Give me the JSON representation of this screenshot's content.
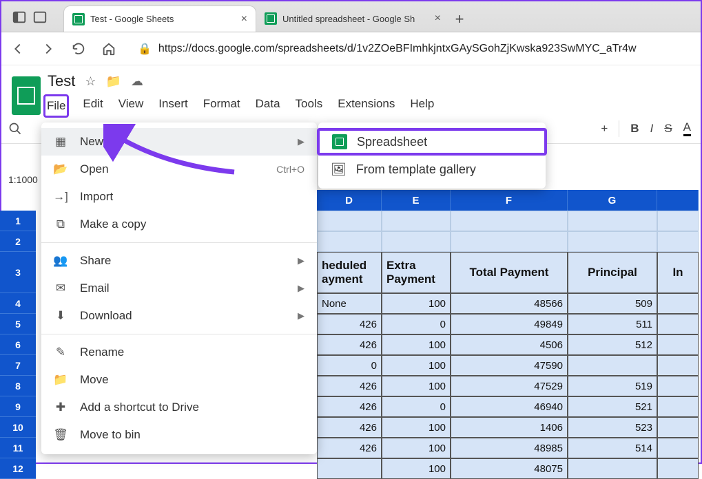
{
  "browser": {
    "tabs": [
      {
        "title": "Test - Google Sheets"
      },
      {
        "title": "Untitled spreadsheet - Google Sh"
      }
    ],
    "url": "https://docs.google.com/spreadsheets/d/1v2ZOeBFImhkjntxGAySGohZjKwska923SwMYC_aTr4w"
  },
  "doc": {
    "title": "Test",
    "menus": [
      "File",
      "Edit",
      "View",
      "Insert",
      "Format",
      "Data",
      "Tools",
      "Extensions",
      "Help"
    ]
  },
  "rangebox": "1:1000",
  "file_menu": {
    "new": "New",
    "open": "Open",
    "open_shortcut": "Ctrl+O",
    "import": "Import",
    "copy": "Make a copy",
    "share": "Share",
    "email": "Email",
    "download": "Download",
    "rename": "Rename",
    "move": "Move",
    "shortcut": "Add a shortcut to Drive",
    "bin": "Move to bin"
  },
  "submenu": {
    "spreadsheet": "Spreadsheet",
    "template": "From template gallery"
  },
  "toolbar": {
    "plus": "+",
    "bold": "B",
    "italic": "I",
    "strike": "S",
    "textcolor": "A"
  },
  "chart_data": {
    "type": "table",
    "range_selected": "1:1000",
    "visible_columns": [
      "D",
      "E",
      "F",
      "G"
    ],
    "visible_rows": [
      1,
      2,
      3,
      4,
      5,
      6,
      7,
      8,
      9,
      10,
      11,
      12
    ],
    "headers_row": 3,
    "headers": {
      "D": "Scheduled Payment",
      "E": "Extra Payment",
      "F": "Total Payment",
      "G": "Principal",
      "H": "Interest"
    },
    "rows": [
      {
        "D": "None",
        "E": 100,
        "F": 48566,
        "G": 509
      },
      {
        "D": 426,
        "E": 0,
        "F": 49849,
        "G": 511
      },
      {
        "D": 426,
        "E": 100,
        "F": 4506,
        "G": 512
      },
      {
        "D": 0,
        "E": 100,
        "F": 47590,
        "G": null
      },
      {
        "D": 426,
        "E": 100,
        "F": 47529,
        "G": 519
      },
      {
        "D": 426,
        "E": 0,
        "F": 46940,
        "G": 521
      },
      {
        "D": 426,
        "E": 100,
        "F": 1406,
        "G": 523
      },
      {
        "D": 426,
        "E": 100,
        "F": 48985,
        "G": 514
      },
      {
        "D": null,
        "E": 100,
        "F": 48075,
        "G": null
      }
    ]
  },
  "col_widths": {
    "D": 94,
    "E": 100,
    "F": 170,
    "G": 130,
    "H": 60
  }
}
